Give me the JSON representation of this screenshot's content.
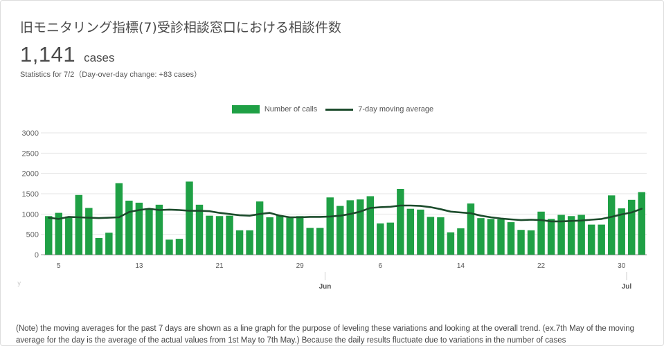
{
  "header": {
    "title": "旧モニタリング指標(7)受診相談窓口における相談件数",
    "value": "1,141",
    "unit": "cases",
    "subtitle": "Statistics for 7/2（Day-over-day change: +83 cases）"
  },
  "legend": {
    "bar_label": "Number of calls",
    "line_label": "7-day moving average"
  },
  "colors": {
    "bar": "#1fa045",
    "line": "#1b4b2b",
    "grid": "#e6e6e6",
    "axis": "#bfbfbf"
  },
  "note": "(Note) the moving averages for the past 7 days are shown as a line graph for the purpose of leveling these variations and looking at the overall trend. (ex.7th May of the moving average for the day is the average of the actual values from 1st May to 7th May.) Because the daily results fluctuate due to variations in the number of cases",
  "faint_tick": "y",
  "chart_data": {
    "type": "bar",
    "x_start": "2020-05-04",
    "x_end": "2020-07-02",
    "x_tick_labels": [
      {
        "date": "2020-05-05",
        "label": "5"
      },
      {
        "date": "2020-05-13",
        "label": "13"
      },
      {
        "date": "2020-05-21",
        "label": "21"
      },
      {
        "date": "2020-05-29",
        "label": "29"
      },
      {
        "date": "2020-06-06",
        "label": "6"
      },
      {
        "date": "2020-06-14",
        "label": "14"
      },
      {
        "date": "2020-06-22",
        "label": "22"
      },
      {
        "date": "2020-06-30",
        "label": "30"
      }
    ],
    "month_labels": [
      {
        "date": "2020-06-01",
        "label": "Jun"
      },
      {
        "date": "2020-07-01",
        "label": "Jul"
      }
    ],
    "ylim": [
      0,
      3000
    ],
    "y_ticks": [
      0,
      500,
      1000,
      1500,
      2000,
      2500,
      3000
    ],
    "grid": true,
    "legend_position": "top-center",
    "series": [
      {
        "name": "Number of calls",
        "type": "bar",
        "values": [
          950,
          1030,
          940,
          1470,
          1150,
          410,
          540,
          1760,
          1330,
          1280,
          1130,
          1230,
          370,
          390,
          1800,
          1230,
          960,
          950,
          960,
          600,
          600,
          1310,
          920,
          970,
          910,
          950,
          660,
          660,
          1410,
          1200,
          1340,
          1360,
          1440,
          770,
          790,
          1620,
          1130,
          1110,
          930,
          920,
          550,
          650,
          1260,
          900,
          880,
          870,
          800,
          610,
          600,
          1060,
          880,
          980,
          950,
          980,
          740,
          740,
          1460,
          1140,
          1350,
          1540
        ]
      },
      {
        "name": "7-day moving average",
        "type": "line",
        "values": [
          910,
          880,
          930,
          920,
          910,
          900,
          910,
          920,
          1050,
          1100,
          1130,
          1100,
          1110,
          1100,
          1080,
          1080,
          1070,
          1030,
          1000,
          970,
          960,
          1000,
          1030,
          960,
          920,
          920,
          930,
          930,
          940,
          960,
          1000,
          1060,
          1150,
          1170,
          1180,
          1210,
          1210,
          1200,
          1170,
          1120,
          1060,
          1040,
          1020,
          960,
          920,
          890,
          870,
          850,
          860,
          850,
          820,
          820,
          830,
          840,
          860,
          880,
          930,
          990,
          1040,
          1130
        ]
      }
    ]
  }
}
